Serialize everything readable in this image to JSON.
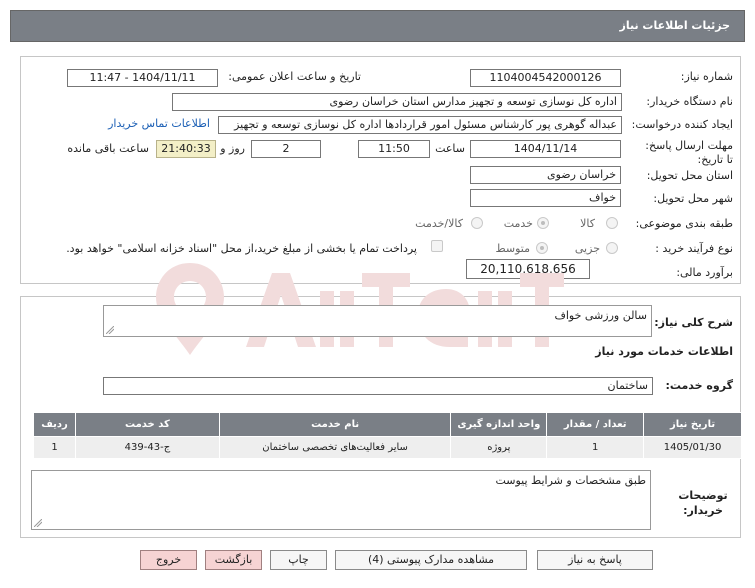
{
  "header": {
    "title": "جزئیات اطلاعات نیاز"
  },
  "fields": {
    "need_number_label": "شماره نیاز:",
    "need_number": "1104004542000126",
    "announce_label": "تاریخ و ساعت اعلان عمومی:",
    "announce_value": "1404/11/11 - 11:47",
    "buyer_label": "نام دستگاه خریدار:",
    "buyer_value": "اداره کل نوسازی  توسعه و تجهیز مدارس استان خراسان رضوی",
    "creator_label": "ایجاد کننده درخواست:",
    "creator_value": "عبداله گوهری پور کارشناس مسئول امور قراردادها  اداره کل نوسازی  توسعه و تجهیز",
    "contact_link": "اطلاعات تماس خریدار",
    "deadline_label": "مهلت ارسال پاسخ: تا تاریخ:",
    "deadline_date": "1404/11/14",
    "time_label": "ساعت",
    "deadline_time": "11:50",
    "days_value": "2",
    "days_label": "روز و",
    "remaining_value": "21:40:33",
    "remaining_label": "ساعت باقی مانده",
    "province_label": "استان محل تحویل:",
    "province_value": "خراسان رضوی",
    "city_label": "شهر محل تحویل:",
    "city_value": "خواف",
    "category_label": "طبقه بندی موضوعی:",
    "category_options": [
      "کالا",
      "خدمت",
      "کالا/خدمت"
    ],
    "process_label": "نوع فرآیند خرید :",
    "process_options": [
      "جزیی",
      "متوسط"
    ],
    "payment_note": "پرداخت تمام یا بخشی از مبلغ خرید،از محل \"اسناد خزانه اسلامی\" خواهد بود.",
    "estimate_label": "برآورد مالی:",
    "estimate_value": "20,110,618,656"
  },
  "summary": {
    "label": "شرح کلی نیاز:",
    "value": "سالن ورزشی خواف"
  },
  "services": {
    "section_title": "اطلاعات خدمات مورد نیاز",
    "group_label": "گروه خدمت:",
    "group_value": "ساختمان",
    "columns": [
      "ردیف",
      "کد خدمت",
      "نام خدمت",
      "واحد اندازه گیری",
      "تعداد / مقدار",
      "تاریخ نیاز"
    ],
    "rows": [
      {
        "row": "1",
        "code": "ج-43-439",
        "name": "سایر فعالیت‌های تخصصی ساختمان",
        "unit": "پروژه",
        "qty": "1",
        "date": "1405/01/30"
      }
    ]
  },
  "notes": {
    "label": "توضیحات خریدار:",
    "value": "طبق مشخصات و شرایط پیوست"
  },
  "buttons": {
    "reply": "پاسخ به نیاز",
    "docs": "مشاهده مدارک پیوستی (4)",
    "print": "چاپ",
    "back": "بازگشت",
    "exit": "خروج"
  },
  "colors": {
    "header_bg": "#7a7f86",
    "link": "#1b5fb5",
    "pink_button": "#f6d3d3",
    "remaining_bg": "#f3efc7"
  }
}
